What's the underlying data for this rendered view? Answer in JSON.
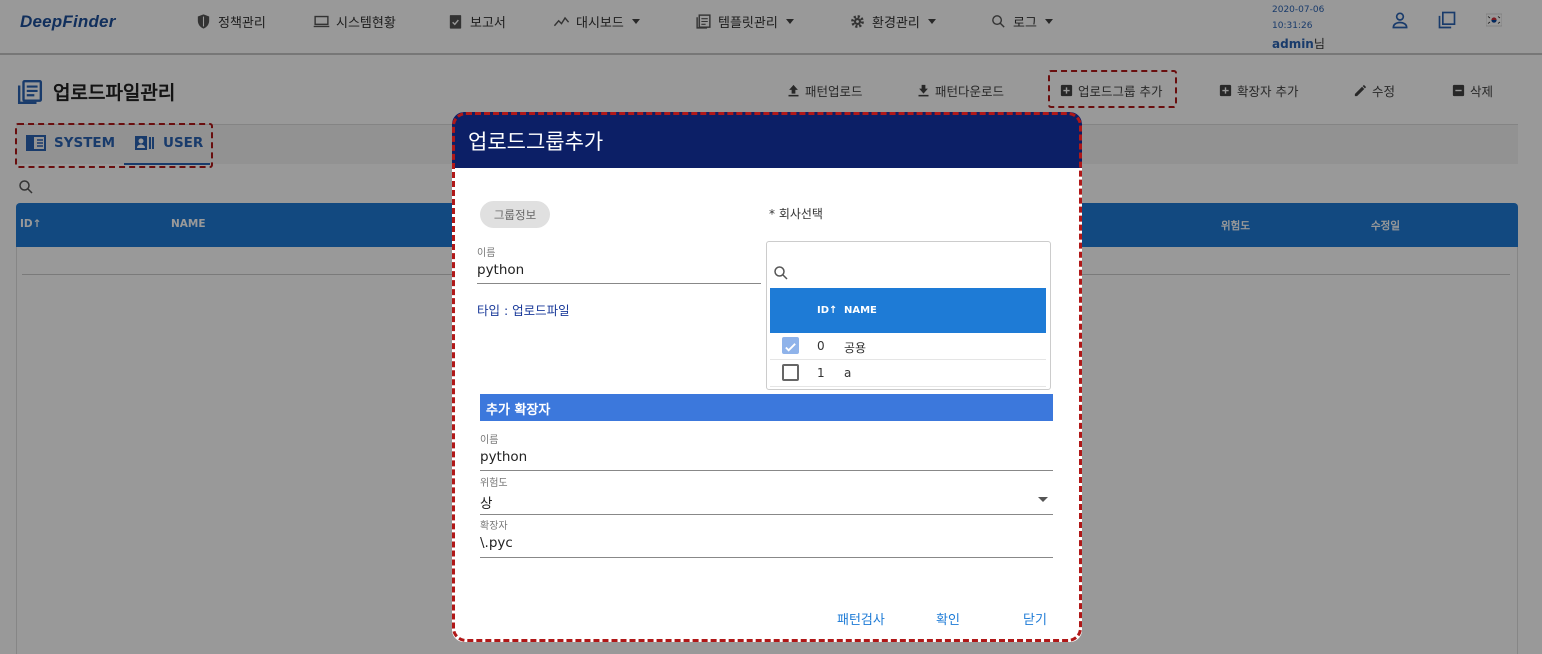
{
  "app": {
    "logo": "DeepFinder"
  },
  "nav": [
    {
      "label": "정책관리",
      "icon": "shield-icon",
      "dropdown": false
    },
    {
      "label": "시스템현황",
      "icon": "monitor-icon",
      "dropdown": false
    },
    {
      "label": "보고서",
      "icon": "clipboard-check-icon",
      "dropdown": false
    },
    {
      "label": "대시보드",
      "icon": "chart-line-icon",
      "dropdown": true
    },
    {
      "label": "템플릿관리",
      "icon": "template-icon",
      "dropdown": true
    },
    {
      "label": "환경관리",
      "icon": "gear-icon",
      "dropdown": true
    },
    {
      "label": "로그",
      "icon": "search-icon",
      "dropdown": true
    }
  ],
  "session": {
    "date": "2020-07-06",
    "time": "10:31:26",
    "user": "admin",
    "suffix": "님"
  },
  "page": {
    "title": "업로드파일관리",
    "actions": [
      {
        "label": "패턴업로드",
        "icon": "upload-icon"
      },
      {
        "label": "패턴다운로드",
        "icon": "download-icon"
      },
      {
        "label": "업로드그룹 추가",
        "icon": "plus-box-icon"
      },
      {
        "label": "확장자 추가",
        "icon": "plus-box-icon"
      },
      {
        "label": "수정",
        "icon": "pencil-icon"
      },
      {
        "label": "삭제",
        "icon": "minus-box-icon"
      }
    ],
    "tabs": [
      {
        "label": "SYSTEM",
        "icon": "sidebar-panel-icon"
      },
      {
        "label": "USER",
        "icon": "user-card-icon"
      }
    ],
    "table": {
      "columns": [
        "ID",
        "NAME",
        "위험도",
        "수정일"
      ],
      "sort_icon": "↑"
    }
  },
  "dialog": {
    "title": "업로드그룹추가",
    "chip": "그룹정보",
    "company_label": "* 회사선택",
    "name_label": "이름",
    "name_value": "python",
    "type_text": "타입 : 업로드파일",
    "company_table": {
      "columns": [
        "ID",
        "NAME"
      ],
      "sort_icon": "↑",
      "rows": [
        {
          "id": "0",
          "name": "공용",
          "checked": true
        },
        {
          "id": "1",
          "name": "a",
          "checked": false
        }
      ]
    },
    "section_title": "추가 확장자",
    "ext_name_label": "이름",
    "ext_name_value": "python",
    "risk_label": "위험도",
    "risk_value": "상",
    "ext_label": "확장자",
    "ext_value": "\\.pyc",
    "buttons": {
      "pattern_check": "패턴검사",
      "confirm": "확인",
      "close": "닫기"
    }
  },
  "colors": {
    "brand_blue": "#1d4f9a",
    "dialog_header": "#0c1f66",
    "table_header": "#1e7bd6",
    "section_bar": "#3c78dc",
    "highlight": "#b01818"
  }
}
